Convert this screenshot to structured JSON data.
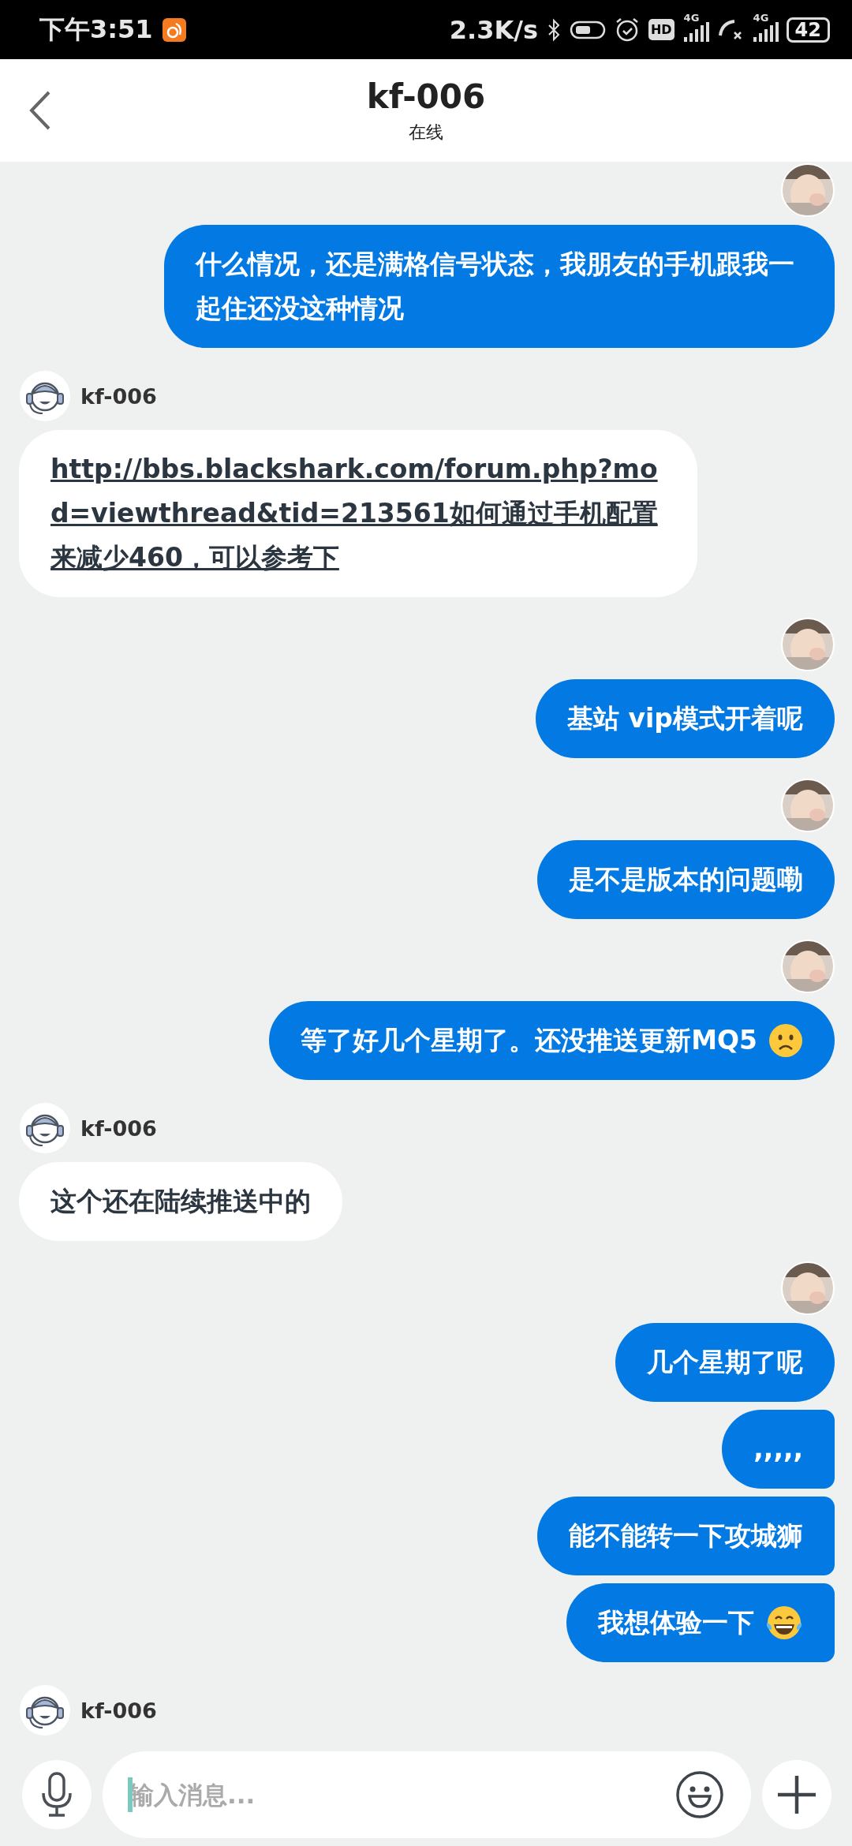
{
  "status_bar": {
    "time": "下午3:51",
    "speed": "2.3K/s",
    "hd": "HD",
    "network_1": "4G",
    "network_2": "4G",
    "battery": "42"
  },
  "header": {
    "title": "kf-006",
    "subtitle": "在线"
  },
  "messages": [
    {
      "kind": "sent",
      "show_avatar": true,
      "text": "什么情况，还是满格信号状态，我朋友的手机跟我一起住还没这种情况"
    },
    {
      "kind": "received",
      "sender": "kf-006",
      "text": "http://bbs.blackshark.com/forum.php?mod=viewthread&tid=213561如何通过手机配置来减少460，可以参考下",
      "link": true
    },
    {
      "kind": "sent",
      "show_avatar": true,
      "text": "基站 vip模式开着呢"
    },
    {
      "kind": "sent",
      "show_avatar": true,
      "text": "是不是版本的问题嘞"
    },
    {
      "kind": "sent",
      "show_avatar": true,
      "text": "等了好几个星期了。还没推送更新MQ5",
      "emoji": {
        "kind": "worried"
      }
    },
    {
      "kind": "received",
      "sender": "kf-006",
      "text": "这个还在陆续推送中的"
    },
    {
      "kind": "sent",
      "show_avatar": true,
      "text": "几个星期了呢"
    },
    {
      "kind": "sent",
      "show_avatar": false,
      "text": ",,,,,"
    },
    {
      "kind": "sent",
      "show_avatar": false,
      "text": "能不能转一下攻城狮"
    },
    {
      "kind": "sent",
      "show_avatar": false,
      "text": "我想体验一下",
      "emoji": {
        "kind": "tears_of_joy"
      }
    },
    {
      "kind": "received",
      "sender": "kf-006"
    }
  ],
  "composer": {
    "placeholder": "输入消息..."
  }
}
